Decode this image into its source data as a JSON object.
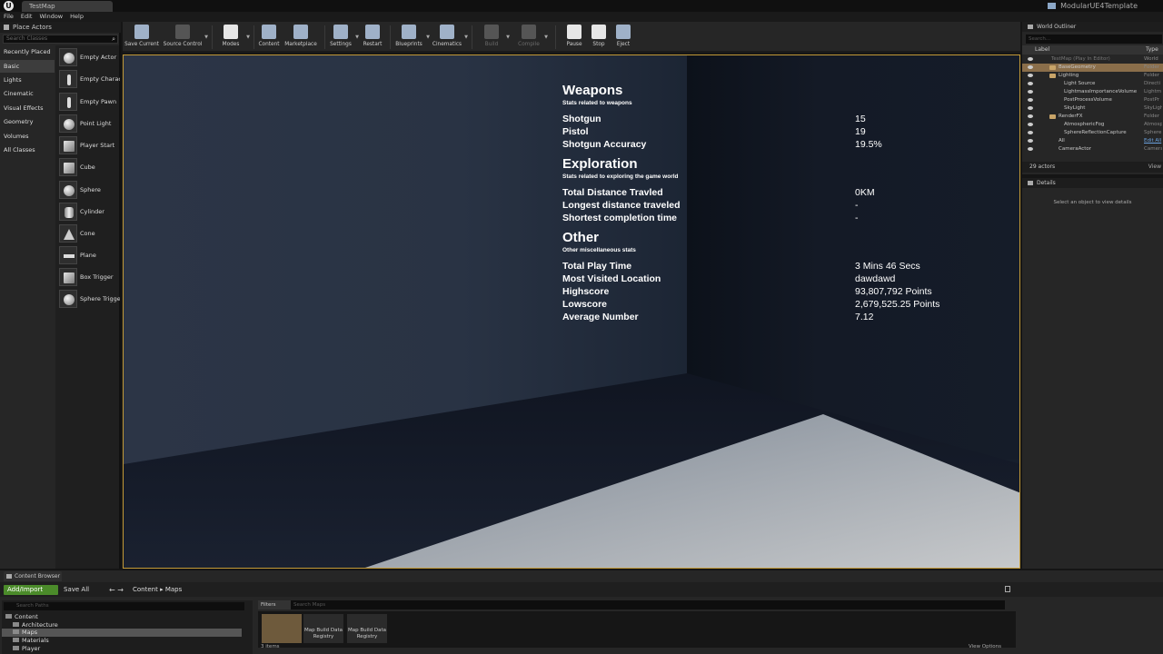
{
  "titlebar": {
    "tab": "TestMap",
    "project": "ModularUE4Template"
  },
  "menu": [
    "File",
    "Edit",
    "Window",
    "Help"
  ],
  "place_actors": {
    "title": "Place Actors",
    "search_placeholder": "Search Classes",
    "categories": [
      "Recently Placed",
      "Basic",
      "Lights",
      "Cinematic",
      "Visual Effects",
      "Geometry",
      "Volumes",
      "All Classes"
    ],
    "active_category": "Basic",
    "items": [
      "Empty Actor",
      "Empty Charac",
      "Empty Pawn",
      "Point Light",
      "Player Start",
      "Cube",
      "Sphere",
      "Cylinder",
      "Cone",
      "Plane",
      "Box Trigger",
      "Sphere Trigge"
    ]
  },
  "toolbar": {
    "save_current": "Save Current",
    "source_control": "Source Control",
    "modes": "Modes",
    "content": "Content",
    "marketplace": "Marketplace",
    "settings": "Settings",
    "restart": "Restart",
    "blueprints": "Blueprints",
    "cinematics": "Cinematics",
    "build": "Build",
    "compile": "Compile",
    "pause": "Pause",
    "stop": "Stop",
    "eject": "Eject"
  },
  "stats": {
    "weapons": {
      "title": "Weapons",
      "subtitle": "Stats related to weapons",
      "rows": [
        {
          "label": "Shotgun",
          "value": "15"
        },
        {
          "label": "Pistol",
          "value": "19"
        },
        {
          "label": "Shotgun Accuracy",
          "value": "19.5%"
        }
      ]
    },
    "exploration": {
      "title": "Exploration",
      "subtitle": "Stats related to exploring the game world",
      "rows": [
        {
          "label": "Total Distance Travled",
          "value": "0KM"
        },
        {
          "label": "Longest distance traveled",
          "value": "-"
        },
        {
          "label": "Shortest completion time",
          "value": "-"
        }
      ]
    },
    "other": {
      "title": "Other",
      "subtitle": "Other miscellaneous stats",
      "rows": [
        {
          "label": "Total Play Time",
          "value": "3 Mins 46 Secs"
        },
        {
          "label": "Most Visited Location",
          "value": "dawdawd"
        },
        {
          "label": "Highscore",
          "value": "93,807,792 Points"
        },
        {
          "label": "Lowscore",
          "value": "2,679,525.25 Points"
        },
        {
          "label": "Average Number",
          "value": "7.12"
        }
      ]
    }
  },
  "outliner": {
    "title": "World Outliner",
    "search_placeholder": "Search...",
    "col_label": "Label",
    "col_type": "Type",
    "rows": [
      {
        "name": "TestMap (Play In Editor)",
        "type": "World"
      },
      {
        "name": "BaseGeometry",
        "type": "Folder"
      },
      {
        "name": "Lighting",
        "type": "Folder"
      },
      {
        "name": "Light Source",
        "type": "Directi"
      },
      {
        "name": "LightmassImportanceVolume",
        "type": "Lightm"
      },
      {
        "name": "PostProcessVolume",
        "type": "PostPr"
      },
      {
        "name": "SkyLight",
        "type": "SkyLigh"
      },
      {
        "name": "RenderFX",
        "type": "Folder"
      },
      {
        "name": "AtmosphericFog",
        "type": "Atmosp"
      },
      {
        "name": "SphereReflectionCapture",
        "type": "Sphere"
      },
      {
        "name": "All",
        "type": "Edit All"
      },
      {
        "name": "CameraActor",
        "type": "Camera"
      }
    ],
    "count": "29 actors",
    "view": "View"
  },
  "details": {
    "title": "Details",
    "message": "Select an object to view details"
  },
  "content_browser": {
    "title": "Content Browser",
    "add_import": "Add/Import",
    "save_all": "Save All",
    "crumb_root": "Content",
    "crumb_leaf": "Maps",
    "search_paths": "Search Paths",
    "tree": [
      "Content",
      "Architecture",
      "Maps",
      "Materials",
      "Player"
    ],
    "filters": "Filters",
    "search_maps": "Search Maps",
    "assets": [
      {
        "label": ""
      },
      {
        "label": "Map Build Data Registry"
      },
      {
        "label": "Map Build Data Registry"
      }
    ],
    "item_count": "3 items",
    "view_options": "View Options"
  }
}
